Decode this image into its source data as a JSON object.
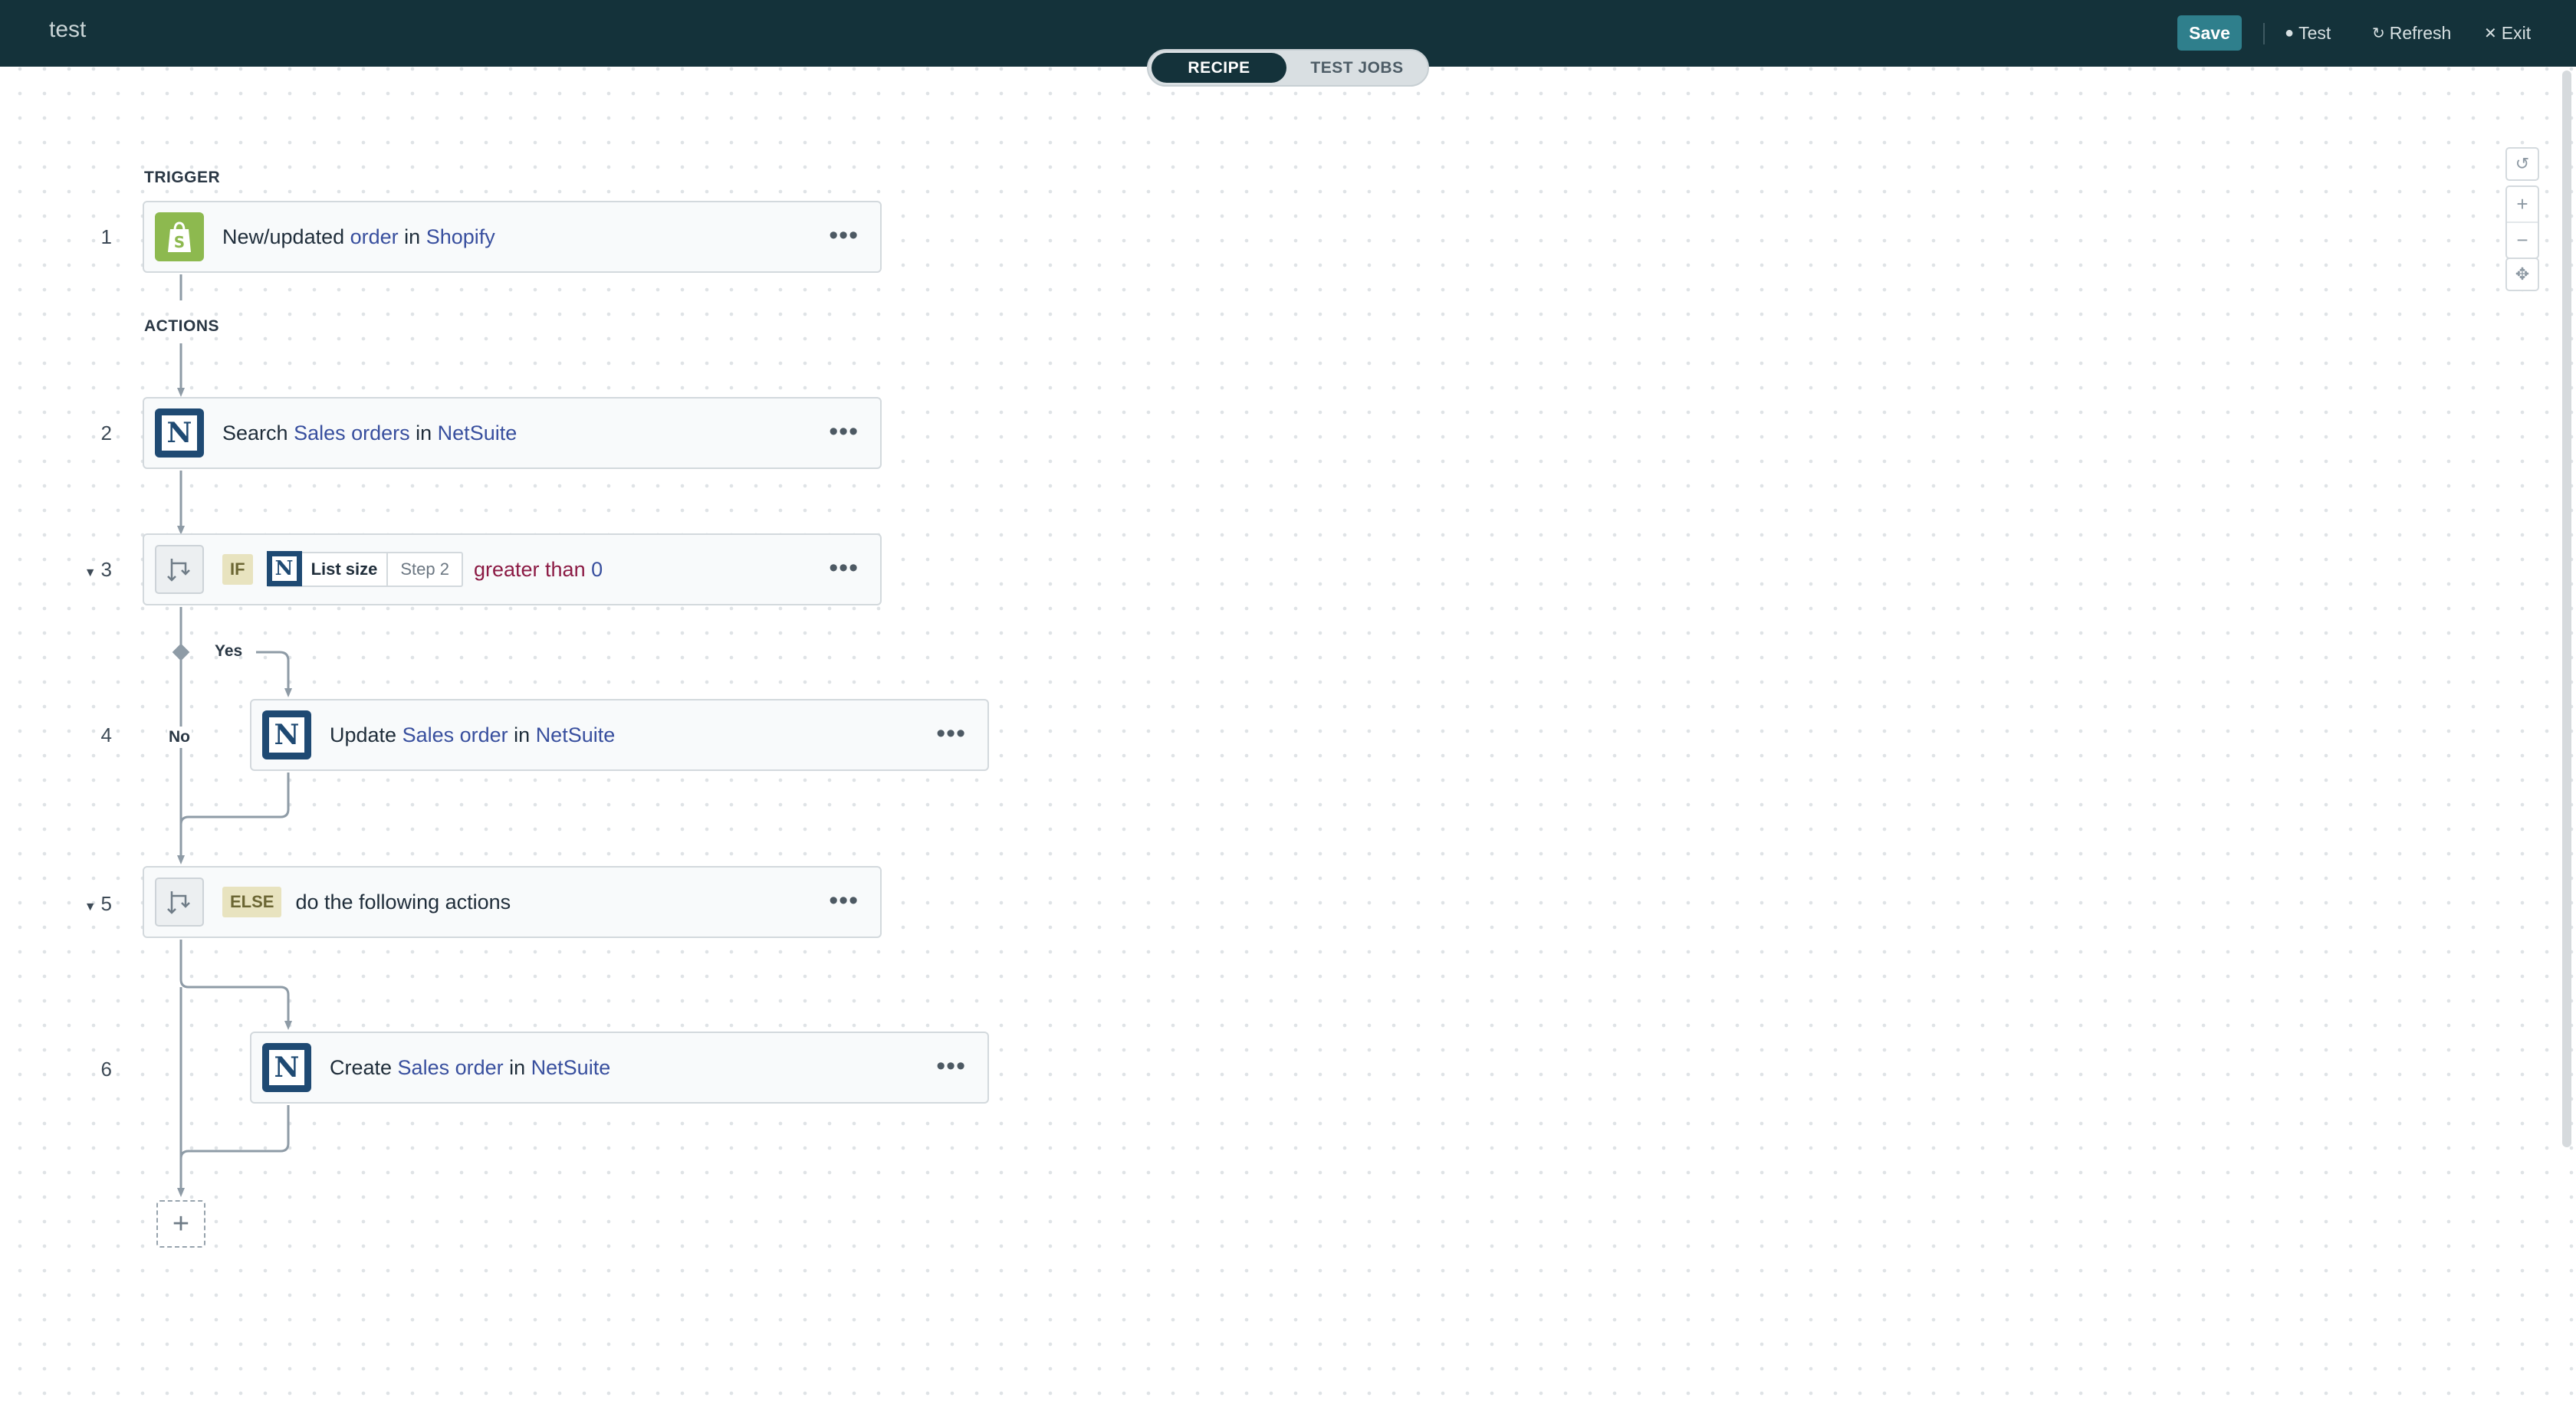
{
  "header": {
    "title": "test",
    "save_label": "Save",
    "test_label": "Test",
    "refresh_label": "Refresh",
    "exit_label": "Exit"
  },
  "tabs": [
    {
      "label": "RECIPE",
      "active": true
    },
    {
      "label": "TEST JOBS",
      "active": false
    }
  ],
  "sections": {
    "trigger": "TRIGGER",
    "actions": "ACTIONS"
  },
  "steps": [
    {
      "num": "1",
      "parts": [
        "New/updated ",
        "order",
        " in ",
        "Shopify"
      ],
      "app": "shopify-icon"
    },
    {
      "num": "2",
      "parts": [
        "Search ",
        "Sales orders",
        " in ",
        "NetSuite"
      ],
      "app": "netsuite-icon"
    },
    {
      "num": "3",
      "badge": "IF",
      "pill_field": "List size",
      "pill_step": "Step 2",
      "op": "greater than",
      "value": "0"
    },
    {
      "num": "4",
      "parts": [
        "Update ",
        "Sales order",
        " in ",
        "NetSuite"
      ],
      "app": "netsuite-icon"
    },
    {
      "num": "5",
      "badge": "ELSE",
      "text": "do the following actions"
    },
    {
      "num": "6",
      "parts": [
        "Create ",
        "Sales order",
        " in ",
        "NetSuite"
      ],
      "app": "netsuite-icon"
    }
  ],
  "branches": {
    "yes": "Yes",
    "no": "No"
  },
  "more_glyph": "•••",
  "add_glyph": "+",
  "netsuite_glyph": "N",
  "colors": {
    "header_bg": "#14323a",
    "save_btn": "#2f7f8c",
    "link": "#384f9e",
    "condition": "#8b1a44",
    "netsuite": "#1f4a73",
    "shopify": "#8db94f"
  }
}
